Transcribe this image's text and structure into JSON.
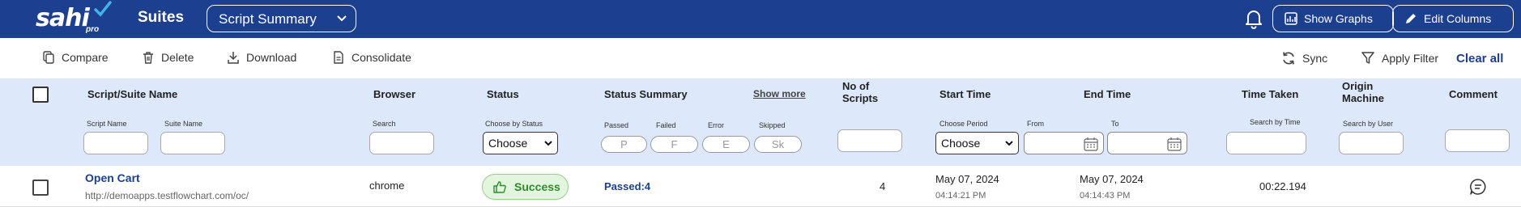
{
  "header": {
    "logo_text": "sahi",
    "logo_sub": "pro",
    "section_title": "Suites",
    "view_select": "Script Summary",
    "show_graphs": "Show Graphs",
    "edit_columns": "Edit Columns"
  },
  "toolbar": {
    "compare": "Compare",
    "delete": "Delete",
    "download": "Download",
    "consolidate": "Consolidate",
    "sync": "Sync",
    "apply_filter": "Apply Filter",
    "clear_all": "Clear all"
  },
  "columns": {
    "name": "Script/Suite Name",
    "name_sub1": "Script Name",
    "name_sub2": "Suite Name",
    "browser": "Browser",
    "browser_sub": "Search",
    "status": "Status",
    "status_sub": "Choose by Status",
    "status_select": "Choose",
    "summary": "Status Summary",
    "show_more": "Show more",
    "passed_sub": "Passed",
    "failed_sub": "Failed",
    "error_sub": "Error",
    "skipped_sub": "Skipped",
    "passed_ph": "P",
    "failed_ph": "F",
    "error_ph": "E",
    "skipped_ph": "Sk",
    "scripts_line1": "No of",
    "scripts_line2": "Scripts",
    "start": "Start Time",
    "period_sub": "Choose Period",
    "period_select": "Choose",
    "from_sub": "From",
    "end": "End Time",
    "to_sub": "To",
    "taken": "Time Taken",
    "taken_sub": "Search by Time",
    "origin_line1": "Origin",
    "origin_line2": "Machine",
    "origin_sub": "Search by User",
    "comment": "Comment"
  },
  "rows": [
    {
      "name": "Open Cart",
      "url": "http://demoapps.testflowchart.com/oc/",
      "browser": "chrome",
      "status": "Success",
      "summary": "Passed:4",
      "scripts": "4",
      "start_date": "May 07, 2024",
      "start_time": "04:14:21 PM",
      "end_date": "May 07, 2024",
      "end_time": "04:14:43 PM",
      "time_taken": "00:22.194"
    }
  ],
  "colors": {
    "primary": "#1d3f8f",
    "header_bg": "#dde8fa",
    "success_bg": "#e2f5dd",
    "success_text": "#2e8b2e"
  }
}
